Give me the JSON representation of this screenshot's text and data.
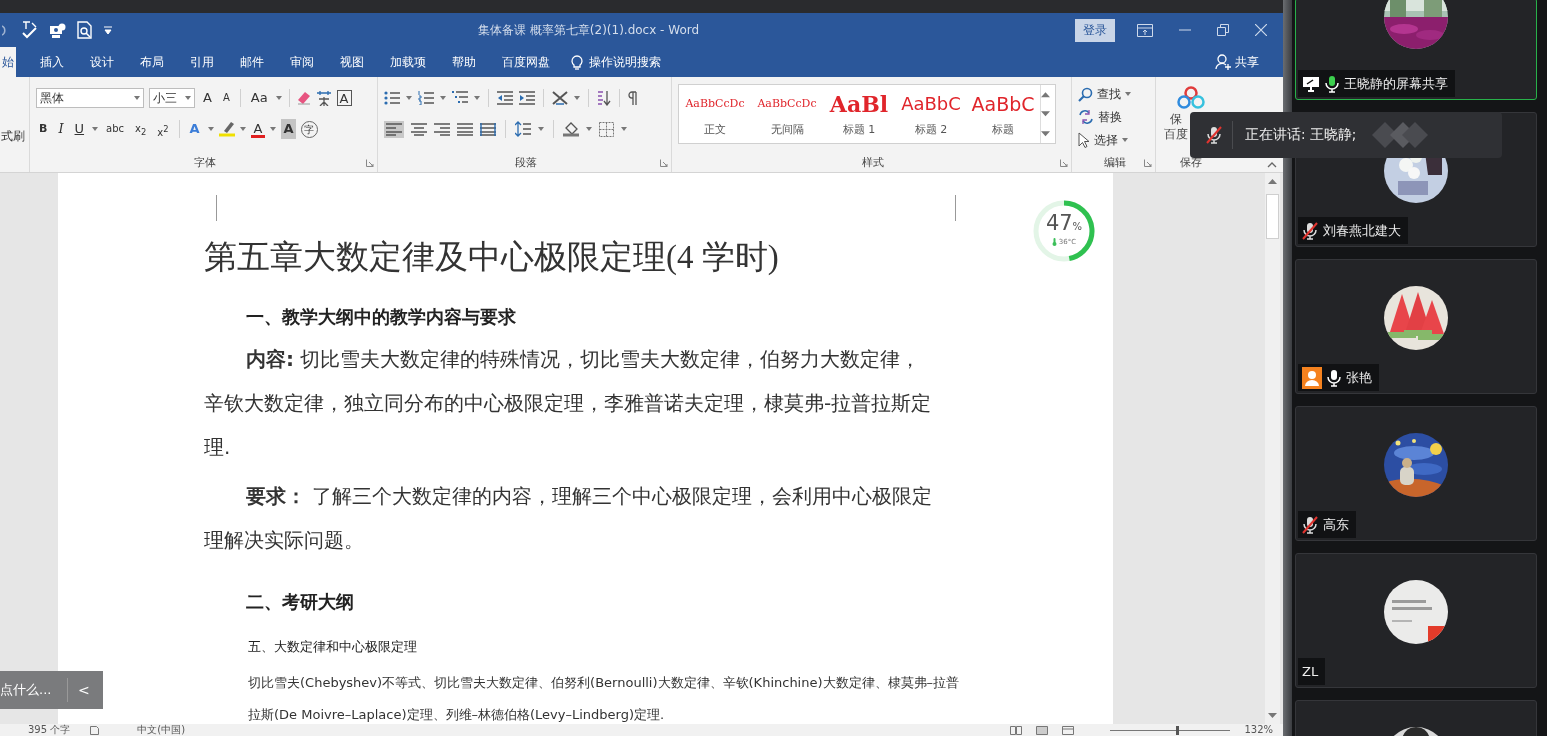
{
  "window": {
    "title": "集体备课 概率第七章(2)(1).docx - Word",
    "sign_in": "登录"
  },
  "tabs": [
    {
      "label": "始",
      "selected": true
    },
    {
      "label": "插入",
      "selected": false
    },
    {
      "label": "设计",
      "selected": false
    },
    {
      "label": "布局",
      "selected": false
    },
    {
      "label": "引用",
      "selected": false
    },
    {
      "label": "邮件",
      "selected": false
    },
    {
      "label": "审阅",
      "selected": false
    },
    {
      "label": "视图",
      "selected": false
    },
    {
      "label": "加载项",
      "selected": false
    },
    {
      "label": "帮助",
      "selected": false
    },
    {
      "label": "百度网盘",
      "selected": false
    }
  ],
  "tell_me": "操作说明搜索",
  "share": "共享",
  "ribbon": {
    "clipboard": {
      "format_painter": "式刷"
    },
    "font": {
      "font_name": "黑体",
      "font_size": "小三",
      "buttons": [
        "A",
        "A",
        "Aa",
        "A",
        "B",
        "I",
        "U",
        "abc",
        "x$_{2}$",
        "x$^{2}$",
        "A",
        "A",
        "A",
        "字"
      ],
      "label": "字体"
    },
    "paragraph": {
      "label": "段落"
    },
    "styles": {
      "items": [
        {
          "sample": "AaBbCcDc",
          "name": "正文",
          "kind": "body"
        },
        {
          "sample": "AaBbCcDc",
          "name": "无间隔",
          "kind": "body"
        },
        {
          "sample": "AaBl",
          "name": "标题 1",
          "kind": "heading1"
        },
        {
          "sample": "AaBbC",
          "name": "标题 2",
          "kind": "heading2"
        },
        {
          "sample": "AaBbC",
          "name": "标题",
          "kind": "title"
        }
      ],
      "label": "样式"
    },
    "editing": {
      "items": [
        {
          "label": "查找",
          "dropdown": true
        },
        {
          "label": "替换",
          "dropdown": false
        },
        {
          "label": "选择",
          "dropdown": true
        }
      ],
      "label": "编辑"
    },
    "save": {
      "button_lines": [
        "保",
        "百度"
      ],
      "label": "保存"
    }
  },
  "document": {
    "blocks": [
      {
        "kind": "title",
        "text": "第五章大数定律及中心极限定理(4 学时)"
      },
      {
        "kind": "heading",
        "text": "一、教学大纲中的教学内容与要求"
      },
      {
        "kind": "body",
        "text": "**内容:** 切比雪夫大数定律的特殊情况，切比雪夫大数定律，伯努力大数定律，辛钦大数定律，独立同分布的中心极限定理，李雅普诺夫定理，棣莫弗-拉普拉斯定理."
      },
      {
        "kind": "body",
        "text": "**要求：** 了解三个大数定律的内容，理解三个中心极限定理，会利用中心极限定理解决实际问题。"
      },
      {
        "kind": "heading",
        "text": "二、考研大纲"
      },
      {
        "kind": "small_heading",
        "text": "五、大数定律和中心极限定理"
      },
      {
        "kind": "small_body",
        "text": "切比雪夫(Chebyshev)不等式、切比雪夫大数定律、伯努利(Bernoulli)大数定律、辛钦(Khinchine)大数定律、棣莫弗–拉普拉斯(De Moivre–Laplace)定理、列维–林德伯格(Levy–Lindberg)定理."
      }
    ]
  },
  "monitor_widget": {
    "percent": "47",
    "unit": "%",
    "temperature": "36°C",
    "level": 0.47
  },
  "side_hint": {
    "text": "点什么...",
    "button": "<"
  },
  "status_bar": {
    "words": "395 个字",
    "language": "中文(中国)",
    "zoom": "132%",
    "zoom_slider": {
      "level": 0.55
    }
  },
  "toast": {
    "text": "正在讲话: 王晓静;"
  },
  "participants": [
    {
      "name": "王晓静的屏幕共享",
      "muted": false,
      "speaking": true,
      "sharing": true,
      "host": false,
      "active": true
    },
    {
      "name": "刘春燕北建大",
      "muted": true,
      "sharing": false,
      "host": false,
      "active": false
    },
    {
      "name": "张艳",
      "muted": false,
      "speaking": false,
      "sharing": false,
      "host": true,
      "active": false
    },
    {
      "name": "高东",
      "muted": true,
      "sharing": false,
      "host": false,
      "active": false
    },
    {
      "name": "ZL",
      "sharing": false,
      "host": false,
      "active": false
    },
    {
      "active": false
    }
  ]
}
